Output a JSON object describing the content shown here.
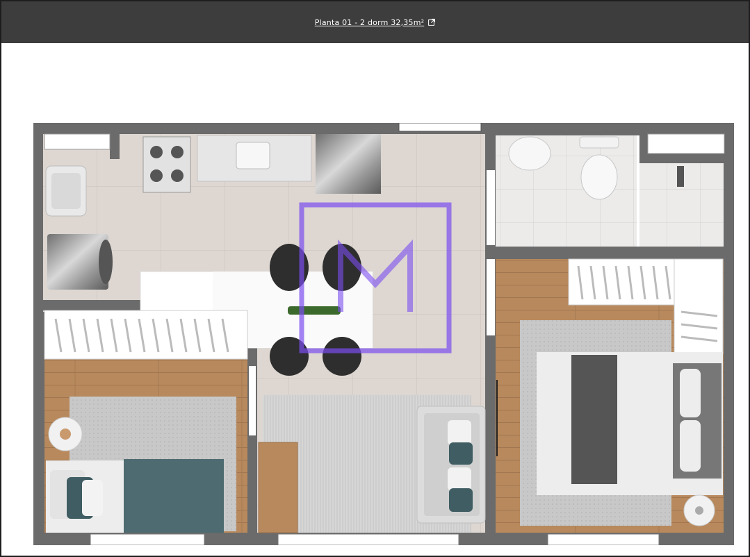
{
  "header": {
    "link_label": "Planta 01 - 2 dorm 32,35m²",
    "link_icon": "external-link-icon"
  },
  "plan": {
    "watermark_letter": "M",
    "watermark_color": "#7b4df0",
    "wall_color": "#6b6b6b",
    "floor_tile_color": "#dcd6d1",
    "floor_wood_color": "#b8895c"
  }
}
